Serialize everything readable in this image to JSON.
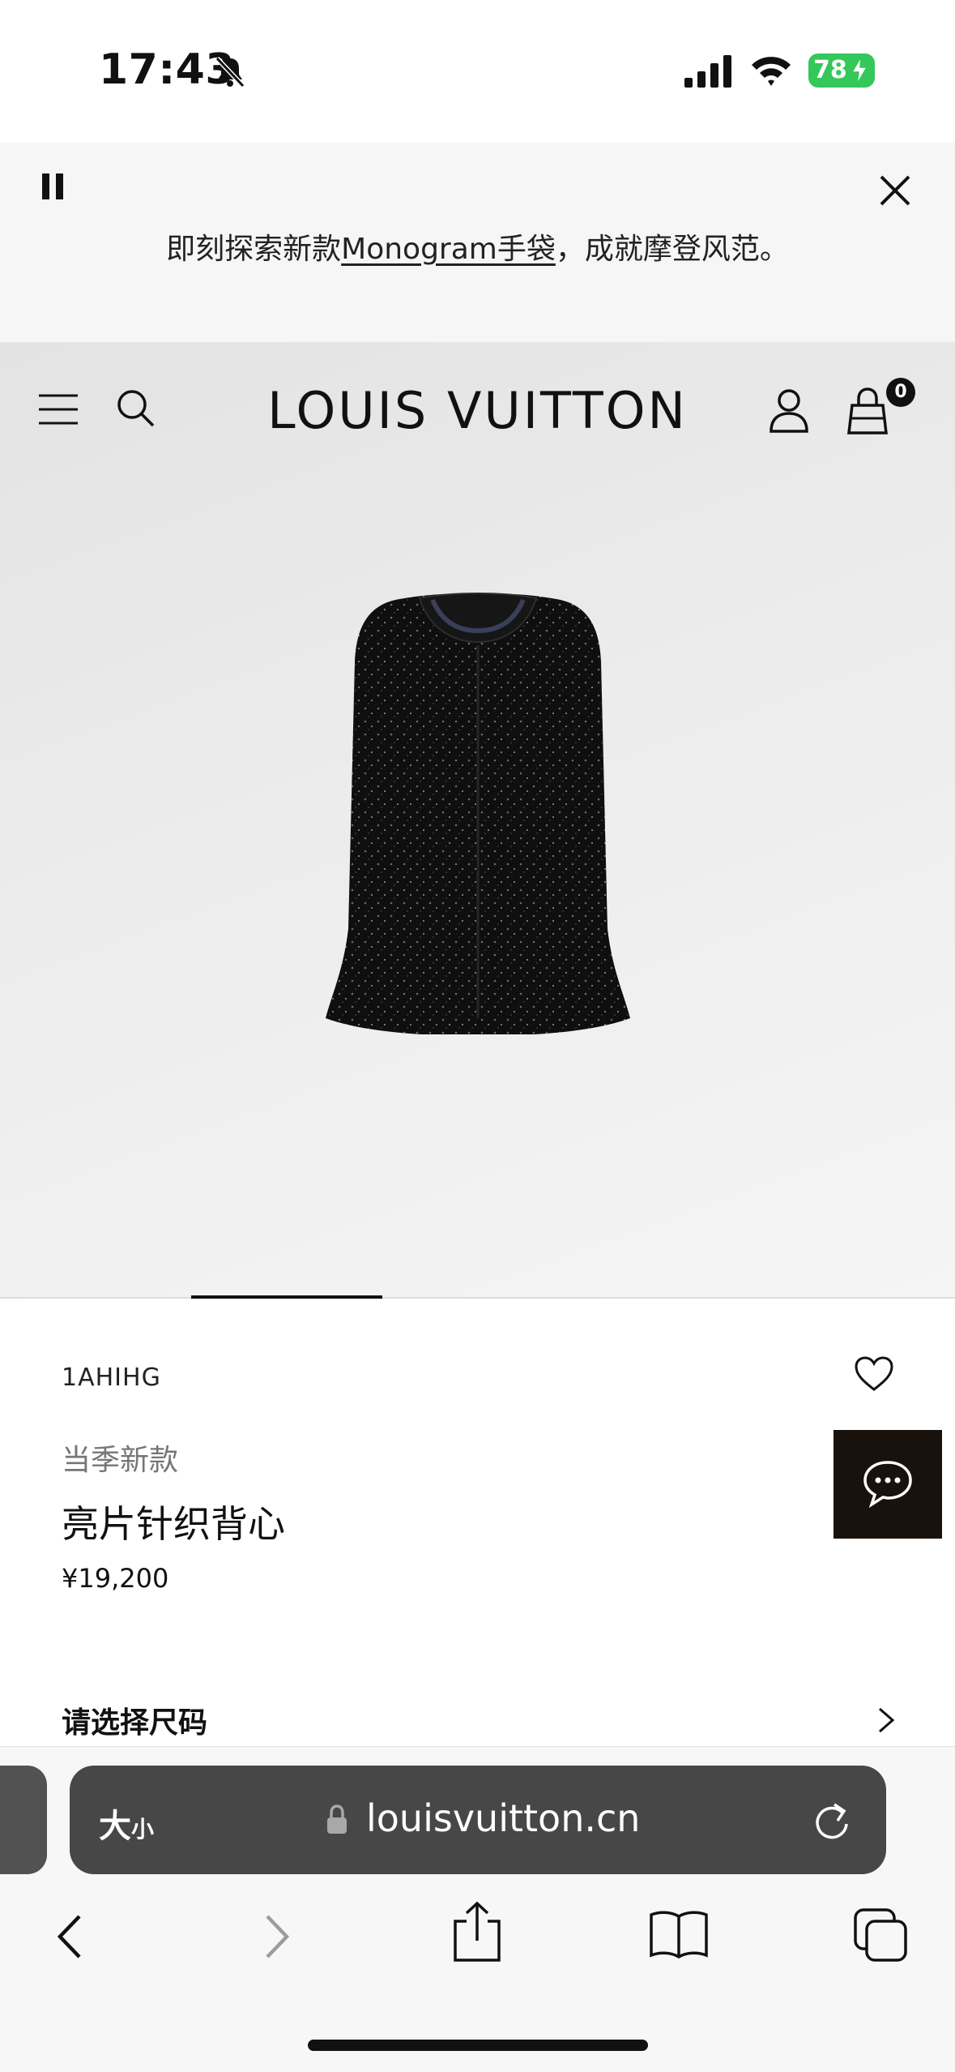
{
  "status_bar": {
    "time": "17:43",
    "battery": "78"
  },
  "promo": {
    "text_before": "即刻探索新款",
    "text_link": "Monogram手袋",
    "text_after": "，成就摩登风范。"
  },
  "header": {
    "logo": "LOUIS VUITTON",
    "bag_count": "0"
  },
  "product": {
    "sku": "1AHIHG",
    "badge": "当季新款",
    "name": "亮片针织背心",
    "price": "¥19,200",
    "size_label": "请选择尺码"
  },
  "carousel": {
    "active_index": 1,
    "count": 5
  },
  "browser": {
    "text_size_big": "大",
    "text_size_small": "小",
    "url": "louisvuitton.cn"
  },
  "icons": [
    "bell-slash-icon",
    "signal-icon",
    "wifi-icon",
    "pause-icon",
    "close-icon",
    "menu-icon",
    "search-icon",
    "account-icon",
    "bag-icon",
    "heart-icon",
    "chat-icon",
    "chevron-right-icon",
    "lock-icon",
    "reload-icon",
    "back-icon",
    "forward-icon",
    "share-icon",
    "bookmarks-icon",
    "tabs-icon"
  ],
  "colors": {
    "accent": "#19110b",
    "battery": "#34c759",
    "address_bar": "#474747"
  }
}
